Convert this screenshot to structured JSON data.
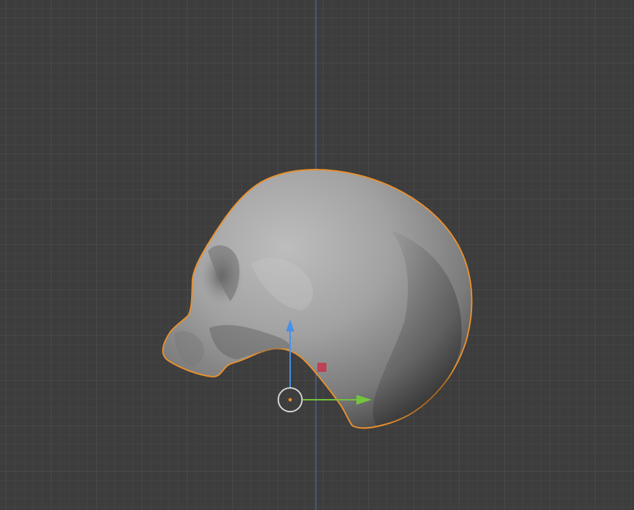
{
  "viewport": {
    "background": "#3d3d3d",
    "grid_color": "#494949",
    "z_axis_color": "#4a77b3",
    "selection_outline": "#e8902f",
    "mesh_base": "#9a9a9a"
  },
  "object": {
    "kind": "skull-mesh",
    "selected": true
  },
  "gizmo": {
    "z_axis_color": "#4a8fe8",
    "y_axis_color": "#74c43c",
    "x_handle_color": "#c2384f",
    "origin_color": "#f08a24",
    "pivot_ring_color": "#d8d8d8"
  }
}
